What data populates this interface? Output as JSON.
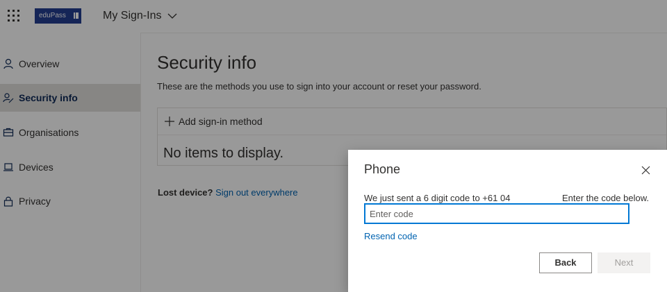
{
  "header": {
    "app_launcher_icon": "waffle-icon",
    "logo_text": "eduPass",
    "app_title": "My Sign-Ins",
    "chevron_icon": "chevron-down-icon"
  },
  "sidebar": {
    "items": [
      {
        "label": "Overview",
        "icon": "person-icon",
        "active": false
      },
      {
        "label": "Security info",
        "icon": "security-info-icon",
        "active": true
      },
      {
        "label": "Organisations",
        "icon": "briefcase-icon",
        "active": false
      },
      {
        "label": "Devices",
        "icon": "laptop-icon",
        "active": false
      },
      {
        "label": "Privacy",
        "icon": "lock-icon",
        "active": false
      }
    ]
  },
  "main": {
    "title": "Security info",
    "subtitle": "These are the methods you use to sign into your account or reset your password.",
    "add_method_label": "Add sign-in method",
    "empty_text": "No items to display.",
    "lost_device_label": "Lost device?",
    "sign_out_link": "Sign out everywhere"
  },
  "dialog": {
    "title": "Phone",
    "message": "We just sent a 6 digit code to +61 04",
    "instruction": "Enter the code below.",
    "code_input": {
      "value": "",
      "placeholder": "Enter code"
    },
    "resend_label": "Resend code",
    "back_label": "Back",
    "next_label": "Next"
  },
  "colors": {
    "brand": "#233e92",
    "link": "#0063b1",
    "focus": "#0078d4",
    "active_nav_text": "#0f2a58"
  }
}
